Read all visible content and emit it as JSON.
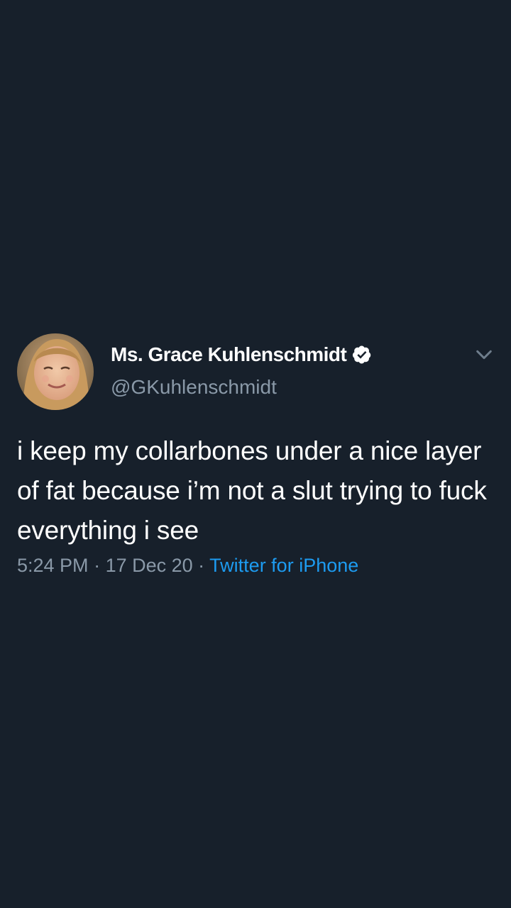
{
  "tweet": {
    "display_name": "Ms. Grace Kuhlenschmidt",
    "handle": "@GKuhlenschmidt",
    "text": "i keep my collarbones under a nice layer of fat because i’m not a slut trying to fuck everything i see",
    "time": "5:24 PM",
    "separator": " · ",
    "date": "17 Dec 20",
    "source": "Twitter for iPhone",
    "verified_icon": "verified-badge-icon",
    "menu_icon": "chevron-down-icon",
    "avatar_icon": "profile-photo"
  },
  "colors": {
    "background": "#17202b",
    "name": "#ffffff",
    "secondary": "#8a99a8",
    "link": "#1d9bf0"
  }
}
